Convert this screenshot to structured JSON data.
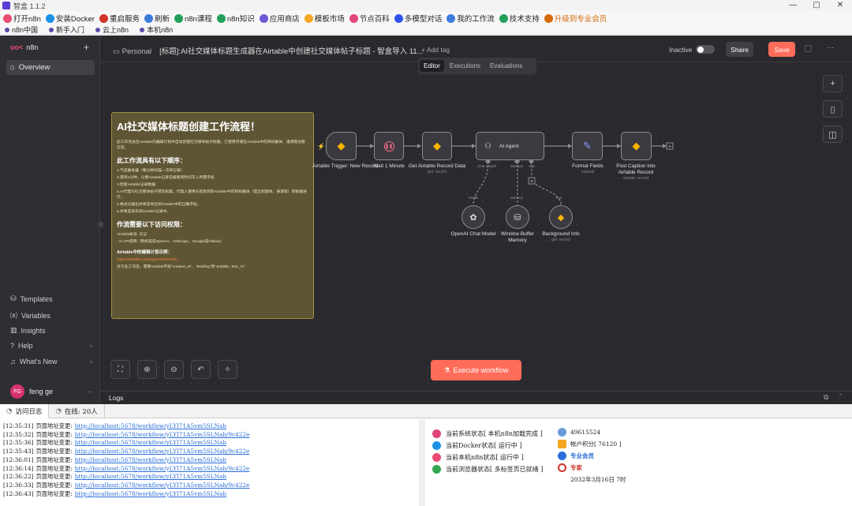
{
  "window": {
    "title": "智盒 1.1.2",
    "controls": [
      "—",
      "▢",
      "✕"
    ]
  },
  "toolbar": [
    {
      "label": "打开n8n",
      "color": "#ea4b71"
    },
    {
      "label": "安装Docker",
      "color": "#1d91e6"
    },
    {
      "label": "重启服务",
      "color": "#d0342c"
    },
    {
      "label": "刷新",
      "color": "#3b7ddd"
    },
    {
      "label": "n8n课程",
      "color": "#22a05a"
    },
    {
      "label": "n8n知识",
      "color": "#22a05a"
    },
    {
      "label": "应用商店",
      "color": "#6b5bd6"
    },
    {
      "label": "模板市场",
      "color": "#f5a623"
    },
    {
      "label": "节点百科",
      "color": "#e0457b"
    },
    {
      "label": "多模型对话",
      "color": "#2f54eb"
    },
    {
      "label": "我的工作流",
      "color": "#3b7ddd"
    },
    {
      "label": "技术支持",
      "color": "#22a05a"
    },
    {
      "label": "升级到专业会员",
      "color": "#d46b08"
    }
  ],
  "bookmarks": [
    "n8n中国",
    "新手入门",
    "云上n8n",
    "本机n8n"
  ],
  "sidebar": {
    "brand": "n8n",
    "overview": "Overview",
    "items": [
      "Templates",
      "Variables",
      "Insights",
      "Help",
      "What's New"
    ],
    "user": {
      "initials": "FG",
      "name": "feng ge"
    }
  },
  "header": {
    "project": "Personal",
    "workflow_name": "[标题]:AI社交媒体标题生成器在Airtable中创建社交媒体帖子标题 - 智盒导入 11...",
    "add_tag": "+ Add tag",
    "status": "Inactive",
    "share": "Share",
    "save": "Save",
    "tabs": [
      "Editor",
      "Executions",
      "Evaluations"
    ],
    "active_tab": "Editor"
  },
  "sticky": {
    "title": "AI社交媒体标题创建工作流程！",
    "intro": "此工作流会在Airtable内编辑计划中自动创建社交媒体帖子标题。它使用存储在Airtable中的目标群体、语调等创意信息。",
    "h_order": "此工作流具有以下顺序：",
    "steps": [
      "1.气自触发器（每分钟扫描一次新记录）",
      "2.等待1分钟，以便Airtable记录在编者有时间写入所需字段",
      "3.检索Airtable记录数据",
      "4.AI代理为社交媒体帖子撰写标题。代理人使用从检索到的Airtable中的目标群体（提出标题体、语调等）的数据进行。",
      "5.格式化输出并将其导出到Airtable中的正确字段。",
      "6.并将其发布到Airtable记录中。"
    ],
    "h_access": "作流需要以下访问权限：",
    "access": [
      "Airtable帐号: 天记",
      "- AI API密钥（例如说说OpenAI、Anthropic、Google或Ollama）"
    ],
    "h_example": "Airtable中的编辑计划示例：",
    "link": "https://airtable.com/appXXXXXX/shr...",
    "note": "对于此工作流，需要Airtable字段\"created_at\"、\"Briefing\"和\"Subtitle_Text_AI\""
  },
  "nodes": [
    {
      "name": "Airtable Trigger: New Record",
      "sub": ""
    },
    {
      "name": "Wait 1 Minute",
      "sub": ""
    },
    {
      "name": "Get Airtable Record Data",
      "sub": "get: record"
    },
    {
      "name": "AI Agent",
      "sub": ""
    },
    {
      "name": "Format Fields",
      "sub": "manual"
    },
    {
      "name": "Post Caption into Airtable Record",
      "sub": "update: record"
    },
    {
      "name": "OpenAI Chat Model",
      "sub": ""
    },
    {
      "name": "Window Buffer Memory",
      "sub": ""
    },
    {
      "name": "Background Info",
      "sub": "get: record"
    }
  ],
  "ports": {
    "chat": "Chat Model*",
    "memory": "Memory",
    "tool": "Tool",
    "model": "Model"
  },
  "canvas": {
    "execute": "Execute workflow",
    "logs": "Logs"
  },
  "bottom": {
    "tabs": [
      {
        "label": "访问日志"
      },
      {
        "label": "在线: 20人"
      }
    ],
    "logs": [
      {
        "time": "[12:35:31]",
        "msg": "页面地址变更:",
        "url": "http://localhost:5678/workflow/yLYI71A5vm5SLNab"
      },
      {
        "time": "[12:35:32]",
        "msg": "页面地址变更:",
        "url": "http://localhost:5678/workflow/yLYI71A5vm5SLNab/9c422e"
      },
      {
        "time": "[12:35:36]",
        "msg": "页面地址变更:",
        "url": "http://localhost:5678/workflow/yLYI71A5vm5SLNab"
      },
      {
        "time": "[12:35:43]",
        "msg": "页面地址变更:",
        "url": "http://localhost:5678/workflow/yLYI71A5vm5SLNab/9c422e"
      },
      {
        "time": "[12:36:01]",
        "msg": "页面地址变更:",
        "url": "http://localhost:5678/workflow/yLYI71A5vm5SLNab"
      },
      {
        "time": "[12:36:14]",
        "msg": "页面地址变更:",
        "url": "http://localhost:5678/workflow/yLYI71A5vm5SLNab/9c422e"
      },
      {
        "time": "[12:36:22]",
        "msg": "页面地址变更:",
        "url": "http://localhost:5678/workflow/yLYI71A5vm5SLNab"
      },
      {
        "time": "[12:36:33]",
        "msg": "页面地址变更:",
        "url": "http://localhost:5678/workflow/yLYI71A5vm5SLNab/9c422e"
      },
      {
        "time": "[12:36:43]",
        "msg": "页面地址变更:",
        "url": "http://localhost:5678/workflow/yLYI71A5vm5SLNab"
      }
    ],
    "status": [
      {
        "label": "当前系统状态[ 本机n8n加载完成 ]",
        "color": "#e0457b"
      },
      {
        "label": "当前Docker状态[ 运行中 ]",
        "color": "#1d91e6"
      },
      {
        "label": "当前本机n8n状态[ 运行中 ]",
        "color": "#ea4b71"
      },
      {
        "label": "当前浏览器状态[ 多标签页已就绪 ]",
        "color": "#34a853"
      }
    ],
    "account": {
      "id": "49615524",
      "points": "帐户积分[ 76120 ]",
      "member": "专业会员",
      "level": "专家",
      "date": "2032年3月16日 7时"
    }
  }
}
